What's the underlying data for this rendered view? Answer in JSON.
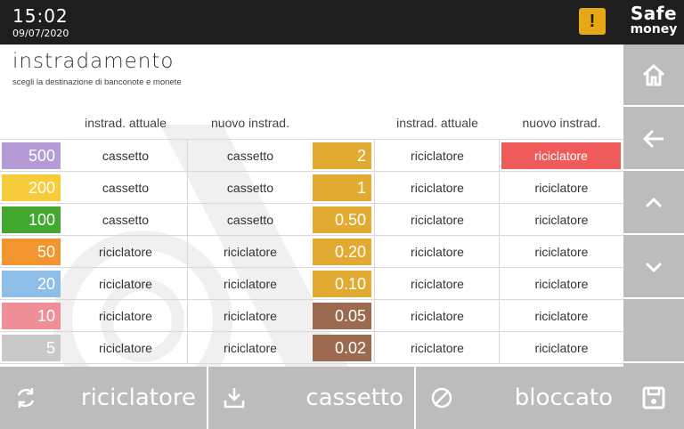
{
  "header": {
    "time": "15:02",
    "date": "09/07/2020",
    "alert_symbol": "!",
    "logo_line1": "Safe",
    "logo_line2": "money"
  },
  "page": {
    "title": "instradamento",
    "subtitle": "scegli la destinazione di banconote e monete"
  },
  "columns": {
    "current": "instrad. attuale",
    "new": "nuovo instrad."
  },
  "banknotes": [
    {
      "value": "500",
      "color": "#b59bd6",
      "current": "cassetto",
      "new": "cassetto"
    },
    {
      "value": "200",
      "color": "#f7cc3a",
      "current": "cassetto",
      "new": "cassetto"
    },
    {
      "value": "100",
      "color": "#43a82f",
      "current": "cassetto",
      "new": "cassetto"
    },
    {
      "value": "50",
      "color": "#f2952e",
      "current": "riciclatore",
      "new": "riciclatore"
    },
    {
      "value": "20",
      "color": "#8ebde8",
      "current": "riciclatore",
      "new": "riciclatore"
    },
    {
      "value": "10",
      "color": "#f08e98",
      "current": "riciclatore",
      "new": "riciclatore"
    },
    {
      "value": "5",
      "color": "#c9c9c9",
      "current": "riciclatore",
      "new": "riciclatore"
    }
  ],
  "coins": [
    {
      "value": "2",
      "color": "#e2aa30",
      "current": "riciclatore",
      "new": "riciclatore",
      "highlight": true
    },
    {
      "value": "1",
      "color": "#e2aa30",
      "current": "riciclatore",
      "new": "riciclatore"
    },
    {
      "value": "0.50",
      "color": "#e2aa30",
      "current": "riciclatore",
      "new": "riciclatore"
    },
    {
      "value": "0.20",
      "color": "#e2aa30",
      "current": "riciclatore",
      "new": "riciclatore"
    },
    {
      "value": "0.10",
      "color": "#e2aa30",
      "current": "riciclatore",
      "new": "riciclatore"
    },
    {
      "value": "0.05",
      "color": "#9b6a4f",
      "current": "riciclatore",
      "new": "riciclatore"
    },
    {
      "value": "0.02",
      "color": "#9b6a4f",
      "current": "riciclatore",
      "new": "riciclatore"
    }
  ],
  "bottom": {
    "recycler_label": "riciclatore",
    "cassette_label": "cassetto",
    "blocked_label": "bloccato"
  },
  "sidebar_icons": [
    "home-icon",
    "back-arrow-icon",
    "chevron-up-icon",
    "chevron-down-icon",
    "save-icon"
  ],
  "colors": {
    "topbar": "#1e1e1e",
    "alert": "#e6a817",
    "highlight": "#ef5b5b",
    "panel_gray": "#bcbcbc"
  }
}
